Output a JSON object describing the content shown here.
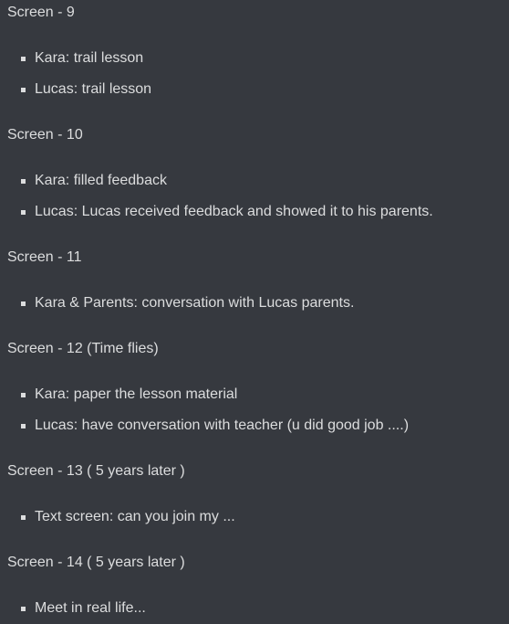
{
  "sections": [
    {
      "heading": "Screen - 9",
      "items": [
        "Kara: trail lesson",
        "Lucas: trail lesson"
      ]
    },
    {
      "heading": "Screen - 10",
      "items": [
        "Kara: filled feedback",
        "Lucas: Lucas received feedback and showed it to his parents."
      ]
    },
    {
      "heading": "Screen - 11",
      "items": [
        "Kara & Parents: conversation with Lucas parents."
      ]
    },
    {
      "heading": "Screen - 12 (Time flies)",
      "items": [
        "Kara: paper the lesson material",
        "Lucas: have conversation with teacher (u did good job ....)"
      ]
    },
    {
      "heading": "Screen - 13 ( 5 years later )",
      "items": [
        "Text screen: can you join my ..."
      ]
    },
    {
      "heading": "Screen - 14 ( 5 years later )",
      "items": [
        "Meet in real life..."
      ]
    }
  ]
}
